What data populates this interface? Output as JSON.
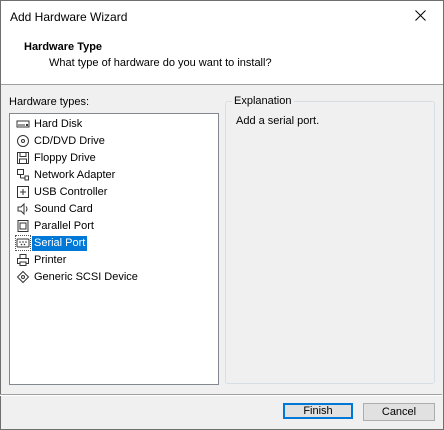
{
  "window": {
    "title": "Add Hardware Wizard",
    "close_icon": "close-icon"
  },
  "header": {
    "title": "Hardware Type",
    "subtitle": "What type of hardware do you want to install?"
  },
  "hardware_list": {
    "label": "Hardware types:",
    "selected": "Serial Port",
    "items": [
      {
        "label": "Hard Disk",
        "icon": "hard-disk-icon"
      },
      {
        "label": "CD/DVD Drive",
        "icon": "cd-dvd-icon"
      },
      {
        "label": "Floppy Drive",
        "icon": "floppy-icon"
      },
      {
        "label": "Network Adapter",
        "icon": "network-adapter-icon"
      },
      {
        "label": "USB Controller",
        "icon": "usb-icon"
      },
      {
        "label": "Sound Card",
        "icon": "speaker-icon"
      },
      {
        "label": "Parallel Port",
        "icon": "parallel-port-icon"
      },
      {
        "label": "Serial Port",
        "icon": "serial-port-icon"
      },
      {
        "label": "Printer",
        "icon": "printer-icon"
      },
      {
        "label": "Generic SCSI Device",
        "icon": "scsi-icon"
      }
    ]
  },
  "explanation": {
    "label": "Explanation",
    "text": "Add a serial port."
  },
  "buttons": {
    "finish": "Finish",
    "cancel": "Cancel"
  }
}
